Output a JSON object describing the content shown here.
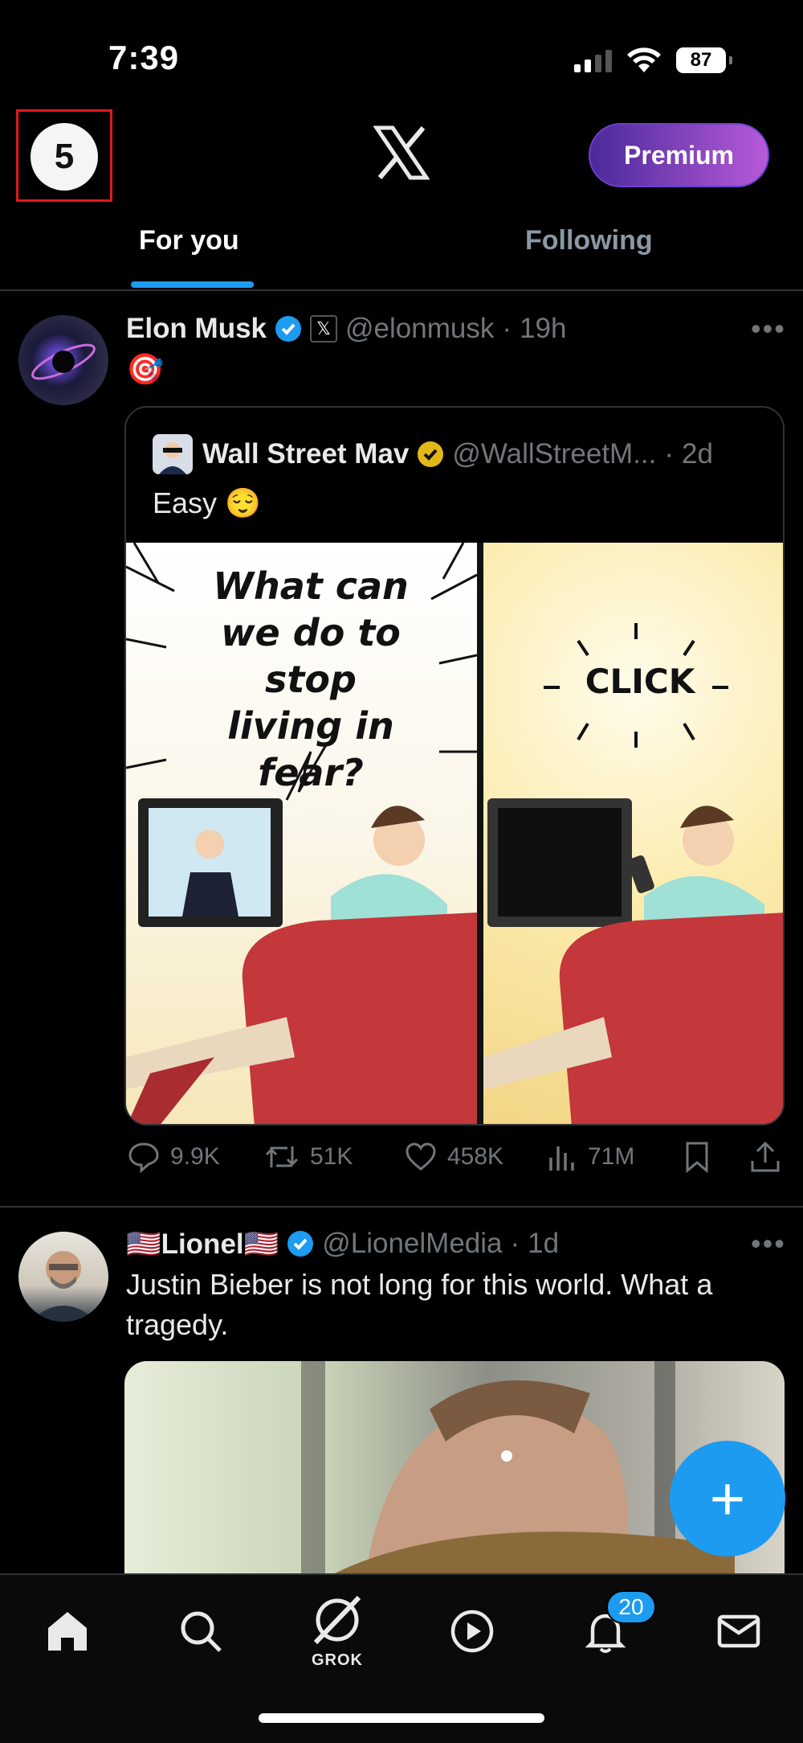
{
  "status_bar": {
    "time": "7:39",
    "battery": "87"
  },
  "header": {
    "profile_badge": "5",
    "premium_label": "Premium"
  },
  "tabs": [
    {
      "label": "For you"
    },
    {
      "label": "Following"
    }
  ],
  "posts": [
    {
      "author_name": "Elon Musk",
      "handle": "@elonmusk",
      "time": "19h",
      "text": "🎯",
      "quote": {
        "author_name": "Wall Street Mav",
        "handle": "@WallStreetM...",
        "time": "2d",
        "text": "Easy 😌",
        "panel_left_text": "What can we do to stop living in fear?",
        "panel_right_text": "CLICK"
      },
      "stats": {
        "replies": "9.9K",
        "reposts": "51K",
        "likes": "458K",
        "views": "71M"
      }
    },
    {
      "author_name": "🇺🇸Lionel🇺🇸",
      "handle": "@LionelMedia",
      "time": "1d",
      "text": "Justin Bieber is not long for this world. What a tragedy."
    }
  ],
  "fab": {
    "label": "+"
  },
  "bottom_nav": {
    "grok_label": "GROK",
    "notifications_count": "20"
  },
  "colors": {
    "accent": "#1d9bf0",
    "verified_gold": "#e2b719",
    "background": "#000000"
  }
}
